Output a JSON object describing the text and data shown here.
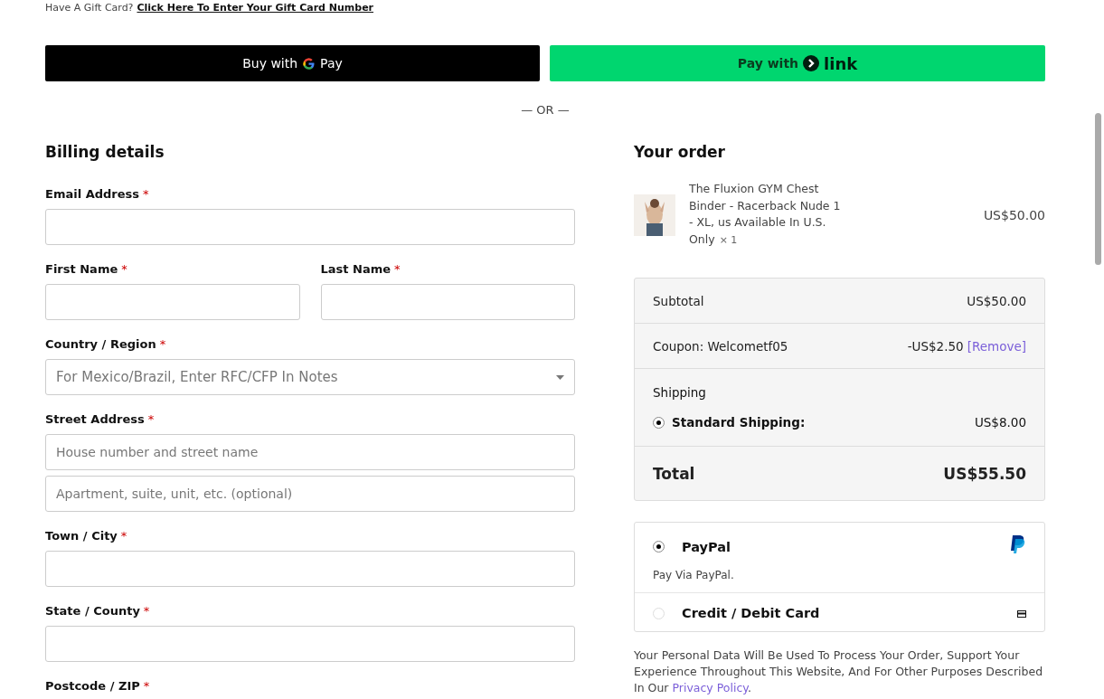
{
  "gift_card": {
    "text": "Have A Gift Card?",
    "link": "Click Here To Enter Your Gift Card Number"
  },
  "express": {
    "gpay_label": "Buy with",
    "gpay_brand": "Pay",
    "link_label": "Pay with",
    "link_brand": "link"
  },
  "separator": "— OR —",
  "billing": {
    "title": "Billing details",
    "rows": [
      [
        {
          "label": "Email Address",
          "mark": "*",
          "kind": "input"
        }
      ],
      [
        {
          "label": "First Name",
          "mark": "*",
          "kind": "input"
        },
        {
          "label": "Last Name",
          "mark": "*",
          "kind": "input"
        }
      ],
      [
        {
          "label": "Country / Region",
          "mark": "*",
          "kind": "select",
          "placeholder": "For Mexico/Brazil, Enter RFC/CFP In Notes"
        }
      ],
      [
        {
          "label": "Street Address",
          "mark": "*",
          "kind": "input",
          "placeholder": "House number and street name"
        }
      ],
      [
        {
          "kind": "input",
          "placeholder": "Apartment, suite, unit, etc. (optional)"
        }
      ],
      [
        {
          "label": "Town / City",
          "mark": "*",
          "kind": "input"
        }
      ],
      [
        {
          "label": "State / County",
          "mark": "*",
          "kind": "input"
        }
      ],
      [
        {
          "label": "Postcode / ZIP",
          "mark": "*",
          "kind": "label"
        }
      ]
    ]
  },
  "order": {
    "title": "Your order",
    "item": {
      "kind": "picture",
      "name": "The Fluxion GYM Chest Binder - Racerback Nude 1 - XL, us Available In U.S. Only",
      "qty": "× 1",
      "price": "US$50.00"
    },
    "subtotal": {
      "label": "Subtotal",
      "value": "US$50.00"
    },
    "coupon": {
      "label": "Coupon: Welcometf05",
      "value": "-US$2.50",
      "remove": "[Remove]"
    },
    "shipping": {
      "label": "Shipping",
      "options": [
        {
          "label": "Standard Shipping:",
          "value": "US$8.00",
          "selected": true
        }
      ]
    },
    "total": {
      "label": "Total",
      "value": "US$55.50"
    }
  },
  "payment_methods": [
    {
      "label": "PayPal",
      "selected": true,
      "kind": "paypal",
      "description": "Pay Via PayPal."
    },
    {
      "label": "Credit / Debit Card",
      "selected": false,
      "kind": "card"
    }
  ],
  "privacy": {
    "text": "Your Personal Data Will Be Used To Process Your Order, Support Your Experience Throughout This Website, And For Other Purposes Described In Our",
    "link": "Privacy Policy",
    "end": "."
  }
}
